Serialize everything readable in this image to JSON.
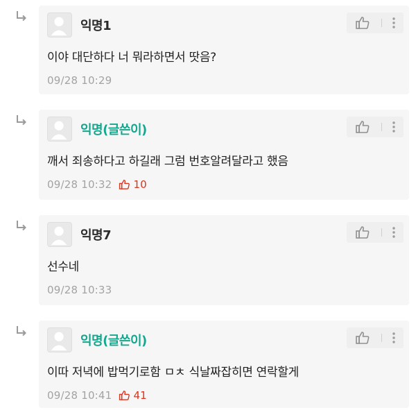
{
  "comments": [
    {
      "author": "익명1",
      "is_op": false,
      "body": "이야 대단하다 너 뭐라하면서 땃음?",
      "time": "09/28 10:29",
      "votes": ""
    },
    {
      "author": "익명(글쓴이)",
      "is_op": true,
      "body": "깨서 죄송하다고 하길래 그럼 번호알려달라고 했음",
      "time": "09/28 10:32",
      "votes": "10"
    },
    {
      "author": "익명7",
      "is_op": false,
      "body": "선수네",
      "time": "09/28 10:33",
      "votes": ""
    },
    {
      "author": "익명(글쓴이)",
      "is_op": true,
      "body": "이따 저녁에 밥먹기로함 ㅁㅊ 식날짜잡히면 연락할게",
      "time": "09/28 10:41",
      "votes": "41"
    }
  ],
  "colors": {
    "op_author": "#13a88e",
    "vote": "#d9341f",
    "card_bg": "#f6f6f6",
    "meta": "#a3a3a3"
  },
  "icons": {
    "reply": "reply-arrow-icon",
    "like": "thumbs-up-icon",
    "more": "more-vertical-icon",
    "avatar": "default-avatar-icon"
  }
}
